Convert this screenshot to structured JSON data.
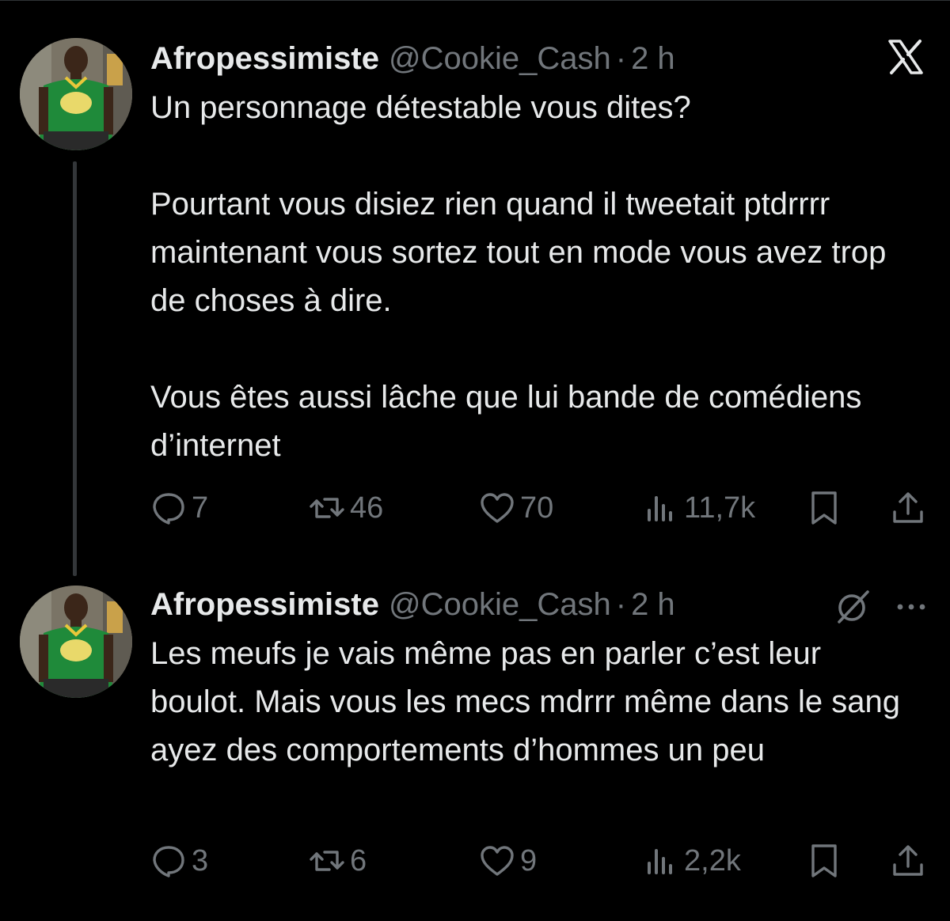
{
  "colors": {
    "background": "#000000",
    "text_primary": "#e7e9ea",
    "text_secondary": "#71767b",
    "thread_line": "#333639"
  },
  "tweets": [
    {
      "author": {
        "display_name": "Afropessimiste",
        "handle": "@Cookie_Cash",
        "separator": "·",
        "time": "2 h"
      },
      "text": "Un personnage détestable vous dites?\n\nPourtant vous disiez rien quand il tweetait ptdrrrr maintenant vous sortez tout en mode vous avez trop de choses à dire.\n\nVous êtes aussi lâche que lui bande de comédiens d’internet",
      "stats": {
        "replies": "7",
        "retweets": "46",
        "likes": "70",
        "views": "11,7k"
      },
      "corner_icon": "x-logo-icon"
    },
    {
      "author": {
        "display_name": "Afropessimiste",
        "handle": "@Cookie_Cash",
        "separator": "·",
        "time": "2 h"
      },
      "text": "Les meufs je vais même pas en parler c’est leur boulot. Mais vous les mecs mdrrr même dans le sang ayez des comportements d’hommes un peu",
      "stats": {
        "replies": "3",
        "retweets": "6",
        "likes": "9",
        "views": "2,2k"
      },
      "corner_icon": "grok-icon"
    }
  ]
}
